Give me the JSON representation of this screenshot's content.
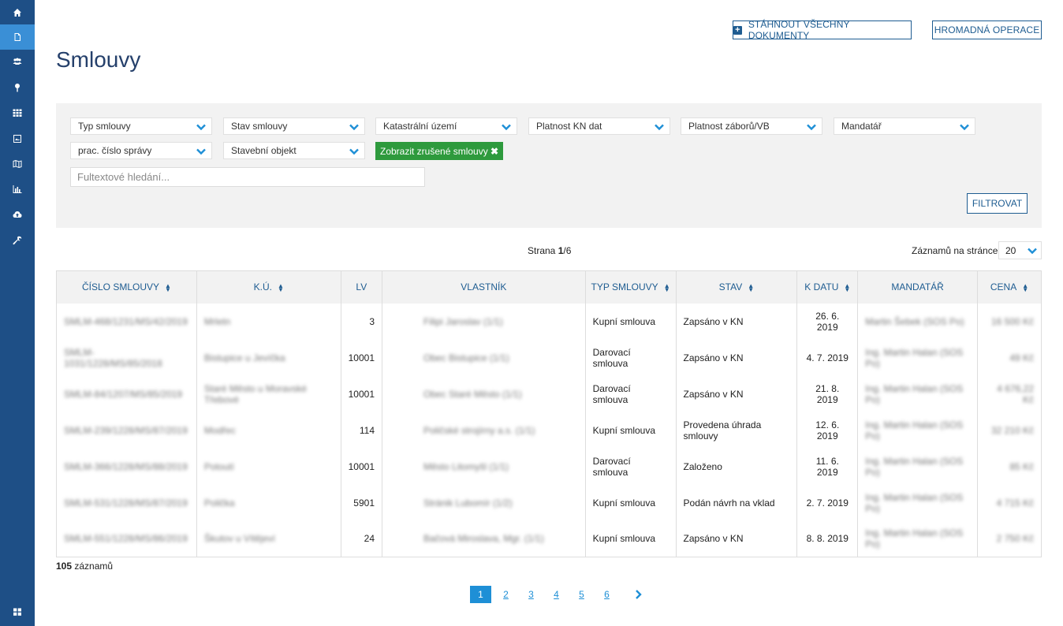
{
  "sidebar": {
    "icons": [
      "home-icon",
      "document-icon",
      "users-icon",
      "pin-icon",
      "grid-icon",
      "image-icon",
      "map-icon",
      "chart-icon",
      "cloud-upload-icon",
      "wrench-icon",
      "apps-icon"
    ],
    "active_index": 1
  },
  "header": {
    "download_all_label": "STÁHNOUT VŠECHNY DOKUMENTY",
    "bulk_operation_label": "HROMADNÁ OPERACE",
    "page_title": "Smlouvy"
  },
  "filters": {
    "row1": [
      "Typ smlouvy",
      "Stav smlouvy",
      "Katastrální území",
      "Platnost KN dat",
      "Platnost záborů/VB",
      "Mandatář"
    ],
    "row2": [
      "prac. číslo správy",
      "Stavební objekt"
    ],
    "chip_label": "Zobrazit zrušené smlouvy",
    "search_placeholder": "Fultextové hledání...",
    "filter_button": "FILTROVAT"
  },
  "paging": {
    "page_label": "Strana",
    "current_page": "1",
    "total_pages": "/6",
    "per_page_label": "Záznamů na stránce",
    "per_page_value": "20",
    "records_count": "105",
    "records_label": " záznamů",
    "pages": [
      "1",
      "2",
      "3",
      "4",
      "5",
      "6"
    ]
  },
  "table": {
    "headers": [
      "ČÍSLO SMLOUVY",
      "K.Ú.",
      "LV",
      "VLASTNÍK",
      "TYP SMLOUVY",
      "STAV",
      "K DATU",
      "MANDATÁŘ",
      "CENA"
    ],
    "rows": [
      {
        "cislo": "SMLM-468/1231/MS/42/2019",
        "ku": "Mrletn",
        "lv": "3",
        "vlastnik": "Filipi Jaroslav (1/1)",
        "typ": "Kupní smlouva",
        "stav": "Zapsáno v KN",
        "datum": "26. 6. 2019",
        "mandatar": "Martin Šebek (SOS Po)",
        "cena": "16 500 Kč"
      },
      {
        "cislo": "SMLM-1031/1228/MS/85/2018",
        "ku": "Bistupice u Jevíčka",
        "lv": "10001",
        "vlastnik": "Obec Bistupice (1/1)",
        "typ": "Darovací smlouva",
        "stav": "Zapsáno v KN",
        "datum": "4. 7. 2019",
        "mandatar": "Ing. Martin Halan (SOS Po)",
        "cena": "49 Kč"
      },
      {
        "cislo": "SMLM-84/1207/MS/85/2019",
        "ku": "Staré Město u Moravské Třebové",
        "lv": "10001",
        "vlastnik": "Obec Staré Město (1/1)",
        "typ": "Darovací smlouva",
        "stav": "Zapsáno v KN",
        "datum": "21. 8. 2019",
        "mandatar": "Ing. Martin Halan (SOS Po)",
        "cena": "4 676,22 Kč"
      },
      {
        "cislo": "SMLM-239/1228/MS/87/2019",
        "ku": "Modřec",
        "lv": "114",
        "vlastnik": "Poličské strojírny a.s. (1/1)",
        "typ": "Kupní smlouva",
        "stav": "Provedena úhrada smlouvy",
        "datum": "12. 6. 2019",
        "mandatar": "Ing. Martin Halan (SOS Po)",
        "cena": "32 210 Kč"
      },
      {
        "cislo": "SMLM-366/1228/MS/88/2019",
        "ku": "Potoutí",
        "lv": "10001",
        "vlastnik": "Město Litomyšl (1/1)",
        "typ": "Darovací smlouva",
        "stav": "Založeno",
        "datum": "11. 6. 2019",
        "mandatar": "Ing. Martin Halan (SOS Po)",
        "cena": "85 Kč"
      },
      {
        "cislo": "SMLM-531/1228/MS/87/2019",
        "ku": "Polička",
        "lv": "5901",
        "vlastnik": "Stránik Lubomír (1/2)",
        "typ": "Kupní smlouva",
        "stav": "Podán návrh na vklad",
        "datum": "2. 7. 2019",
        "mandatar": "Ing. Martin Halan (SOS Po)",
        "cena": "4 715 Kč"
      },
      {
        "cislo": "SMLM-551/1228/MS/86/2019",
        "ku": "Škutov u Vítějeví",
        "lv": "24",
        "vlastnik": "Bačová Miroslava, Mgr. (1/1)",
        "typ": "Kupní smlouva",
        "stav": "Zapsáno v KN",
        "datum": "8. 8. 2019",
        "mandatar": "Ing. Martin Halan (SOS Po)",
        "cena": "2 750 Kč"
      }
    ]
  },
  "colors": {
    "sidebar": "#1e4f86",
    "sidebar_active": "#3a8fd6",
    "primary": "#1e5c91",
    "chip": "#2e9a3d",
    "link": "#1e8fd6"
  }
}
